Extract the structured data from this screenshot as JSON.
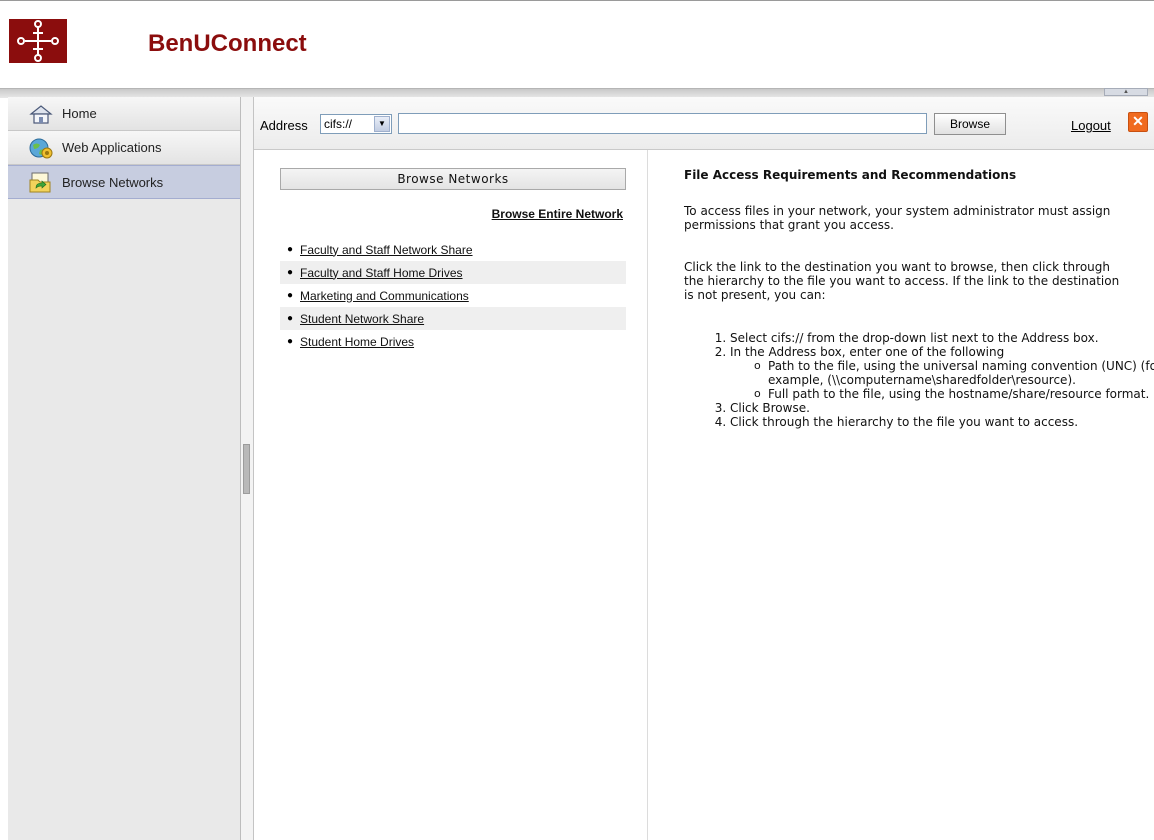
{
  "header": {
    "app_title": "BenUConnect"
  },
  "sidebar": {
    "items": [
      {
        "label": "Home",
        "icon": "home-icon"
      },
      {
        "label": "Web Applications",
        "icon": "globe-gear-icon"
      },
      {
        "label": "Browse Networks",
        "icon": "folder-arrow-icon",
        "active": true
      }
    ]
  },
  "toolbar": {
    "address_label": "Address",
    "protocol_selected": "cifs://",
    "address_value": "",
    "browse_label": "Browse",
    "logout_label": "Logout"
  },
  "browse_panel": {
    "header": "Browse Networks",
    "browse_entire_link": "Browse Entire Network",
    "networks": [
      "Faculty and Staff Network Share",
      "Faculty and Staff Home Drives",
      "Marketing and Communications",
      "Student Network Share",
      "Student Home Drives"
    ]
  },
  "help": {
    "title": "File Access Requirements and Recommendations",
    "para1": "To access files in your network, your system administrator must assign permissions that grant you access.",
    "para2": "Click the link to the destination you want to browse, then click through the hierarchy to the file you want to access. If the link to the destination is not present, you can:",
    "steps": [
      "Select cifs:// from the drop-down list next to the Address box.",
      "In the Address box, enter one of the following",
      "Click Browse.",
      "Click through the hierarchy to the file you want to access."
    ],
    "substeps": [
      "Path to the file, using the universal naming convention (UNC) (for example, (\\\\computername\\sharedfolder\\resource).",
      "Full path to the file, using the hostname/share/resource format."
    ]
  },
  "colors": {
    "brand": "#8b0d0d",
    "active_nav": "#c7cde0",
    "logout_icon": "#f06a1e"
  }
}
